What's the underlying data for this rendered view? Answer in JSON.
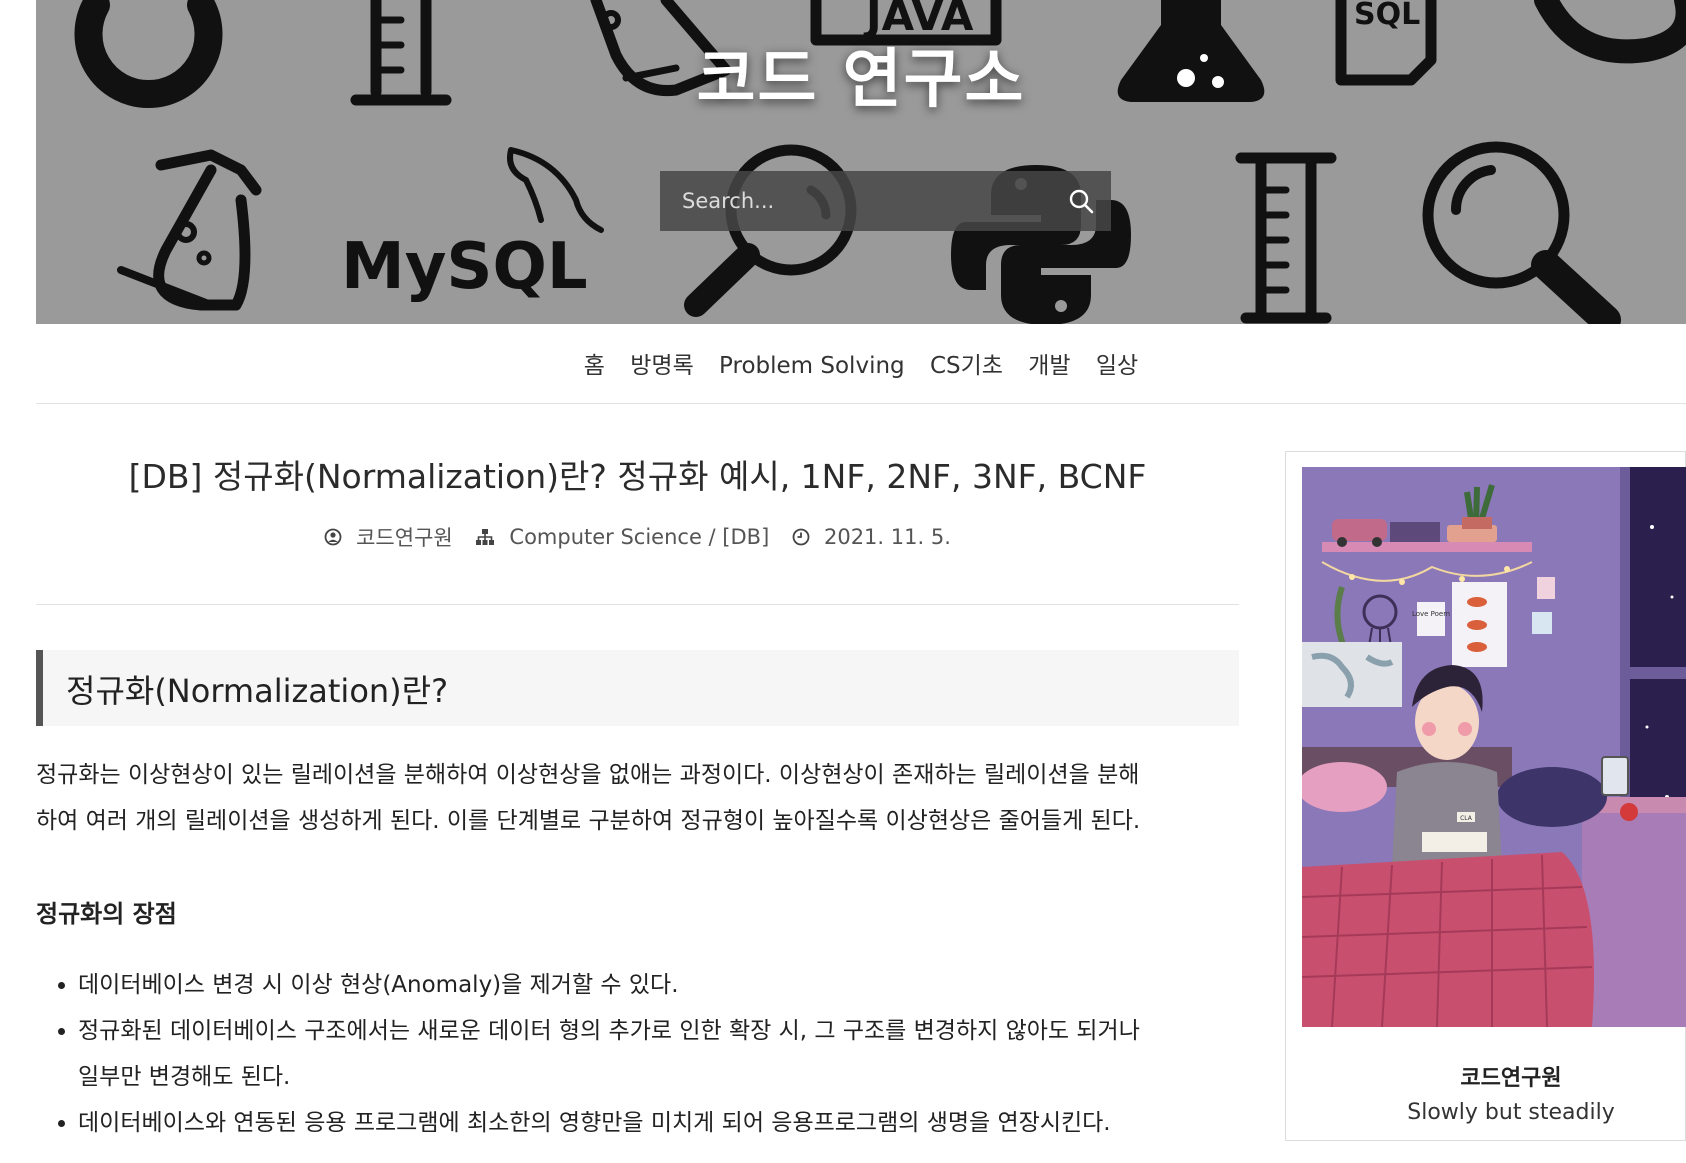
{
  "site": {
    "title": "코드 연구소",
    "search_placeholder": "Search...",
    "banner_text": [
      "JAVA",
      "SQL",
      "MySQL"
    ]
  },
  "nav": {
    "items": [
      "홈",
      "방명록",
      "Problem Solving",
      "CS기초",
      "개발",
      "일상"
    ]
  },
  "post": {
    "title": "[DB] 정규화(Normalization)란? 정규화 예시, 1NF, 2NF, 3NF, BCNF",
    "author": "코드연구원",
    "category": "Computer Science / [DB]",
    "date": "2021. 11. 5.",
    "section_heading": "정규화(Normalization)란?",
    "intro_line1": "정규화는 이상현상이 있는 릴레이션을 분해하여 이상현상을 없애는 과정이다. 이상현상이 존재하는 릴레이션을 분해",
    "intro_line2": "하여 여러 개의 릴레이션을 생성하게 된다. 이를 단계별로 구분하여 정규형이 높아질수록 이상현상은 줄어들게 된다.",
    "advantages_heading": "정규화의 장점",
    "advantages": [
      "데이터베이스 변경 시 이상 현상(Anomaly)을 제거할 수 있다.",
      "정규화된 데이터베이스 구조에서는 새로운 데이터 형의 추가로 인한 확장 시, 그 구조를 변경하지 않아도 되거나\n일부만 변경해도 된다.",
      "데이터베이스와 연동된 응용 프로그램에 최소한의 영향만을 미치게 되어 응용프로그램의 생명을 연장시킨다."
    ]
  },
  "profile": {
    "name": "코드연구원",
    "description": "Slowly but steadily",
    "illustration_text": [
      "Love Poem",
      "CLA"
    ]
  },
  "colors": {
    "banner_bg": "#9a9a9a",
    "heading_bar": "#555555",
    "heading_bg": "#f6f6f6",
    "illus_wall": "#8b78b8",
    "illus_bed": "#c94f6f"
  }
}
